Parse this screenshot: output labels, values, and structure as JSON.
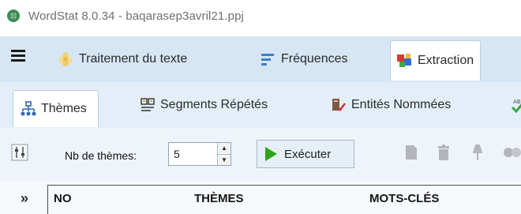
{
  "window": {
    "title": "WordStat 8.0.34 - baqarasep3avril21.ppj"
  },
  "ribbon": {
    "tabs": [
      {
        "label": "Traitement du texte",
        "icon": "flower-icon",
        "active": false
      },
      {
        "label": "Fréquences",
        "icon": "frequency-lines-icon",
        "active": false
      },
      {
        "label": "Extraction",
        "icon": "colored-blocks-icon",
        "active": true
      }
    ]
  },
  "subtabs": [
    {
      "label": "Thèmes",
      "icon": "hierarchy-icon",
      "active": true
    },
    {
      "label": "Segments Répétés",
      "icon": "segments-icon",
      "active": false
    },
    {
      "label": "Entités Nommées",
      "icon": "entity-check-icon",
      "active": false
    }
  ],
  "toolbar": {
    "nb_label": "Nb de thèmes:",
    "nb_value": "5",
    "run_label": "Exécuter"
  },
  "table": {
    "expand_symbol": "»",
    "columns": [
      "NO",
      "THÈMES",
      "MOTS-CLÉS"
    ]
  },
  "colors": {
    "ribbon_bg": "#d6e6f4",
    "play_green": "#2fa31a",
    "title_gray": "#6f6f6f"
  }
}
